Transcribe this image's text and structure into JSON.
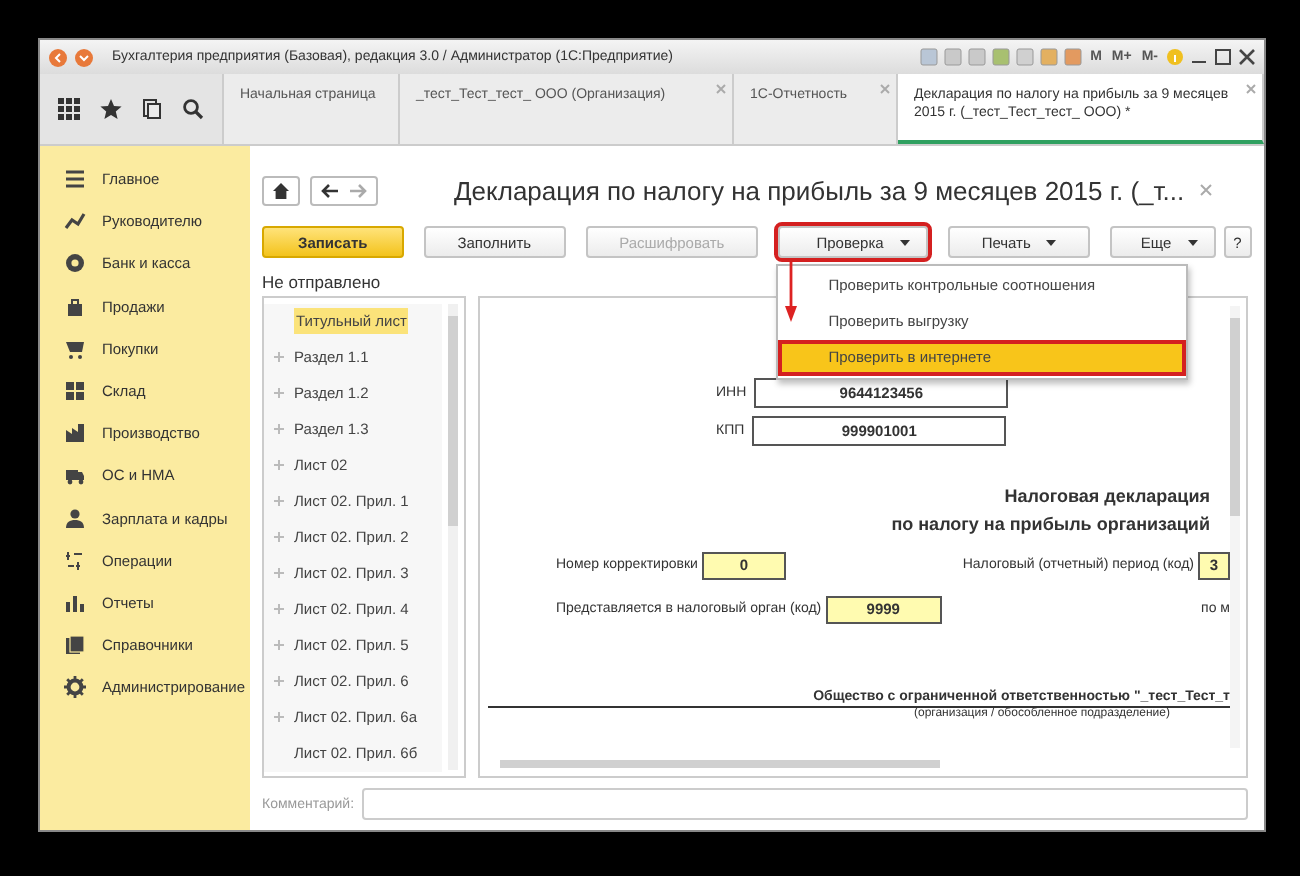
{
  "window": {
    "title": "Бухгалтерия предприятия (Базовая), редакция 3.0 / Администратор  (1С:Предприятие)",
    "memory_buttons": [
      "M",
      "M+",
      "M-"
    ]
  },
  "tabs": [
    {
      "label": "Начальная страница",
      "selected": false,
      "closable": false
    },
    {
      "label": "_тест_Тест_тест_ ООО (Организация)",
      "selected": false,
      "closable": true
    },
    {
      "label": "1С-Отчетность",
      "selected": false,
      "closable": true
    },
    {
      "label": "Декларация по налогу на прибыль за 9 месяцев 2015 г. (_тест_Тест_тест_ ООО) *",
      "selected": true,
      "closable": true
    }
  ],
  "sidebar": {
    "items": [
      {
        "label": "Главное"
      },
      {
        "label": "Руководителю"
      },
      {
        "label": "Банк и касса"
      },
      {
        "label": "Продажи"
      },
      {
        "label": "Покупки"
      },
      {
        "label": "Склад"
      },
      {
        "label": "Производство"
      },
      {
        "label": "ОС и НМА"
      },
      {
        "label": "Зарплата и кадры"
      },
      {
        "label": "Операции"
      },
      {
        "label": "Отчеты"
      },
      {
        "label": "Справочники"
      },
      {
        "label": "Администрирование"
      }
    ]
  },
  "document": {
    "title": "Декларация по налогу на прибыль за 9 месяцев 2015 г. (_т...",
    "toolbar": [
      {
        "label": "Записать",
        "kind": "primary",
        "disabled": false,
        "dropdown": false,
        "highlighted": false
      },
      {
        "label": "Заполнить",
        "kind": "normal",
        "disabled": false,
        "dropdown": false,
        "highlighted": false
      },
      {
        "label": "Расшифровать",
        "kind": "normal",
        "disabled": true,
        "dropdown": false,
        "highlighted": false
      },
      {
        "label": "Проверка",
        "kind": "normal",
        "disabled": false,
        "dropdown": true,
        "highlighted": true
      },
      {
        "label": "Печать",
        "kind": "normal",
        "disabled": false,
        "dropdown": true,
        "highlighted": false
      },
      {
        "label": "Еще",
        "kind": "more",
        "disabled": false,
        "dropdown": true,
        "highlighted": false
      },
      {
        "label": "?",
        "kind": "help",
        "disabled": false,
        "dropdown": false,
        "highlighted": false
      }
    ],
    "menu": [
      {
        "label": "Проверить контрольные соотношения",
        "selected": false
      },
      {
        "label": "Проверить выгрузку",
        "selected": false
      },
      {
        "label": "Проверить в интернете",
        "selected": true
      }
    ],
    "status": "Не отправлено",
    "sections": [
      {
        "label": "Титульный лист",
        "selected": true,
        "expandable": false
      },
      {
        "label": "Раздел 1.1",
        "selected": false,
        "expandable": true
      },
      {
        "label": "Раздел 1.2",
        "selected": false,
        "expandable": true
      },
      {
        "label": "Раздел 1.3",
        "selected": false,
        "expandable": true
      },
      {
        "label": "Лист 02",
        "selected": false,
        "expandable": true
      },
      {
        "label": "Лист 02. Прил. 1",
        "selected": false,
        "expandable": true
      },
      {
        "label": "Лист 02. Прил. 2",
        "selected": false,
        "expandable": true
      },
      {
        "label": "Лист 02. Прил. 3",
        "selected": false,
        "expandable": true
      },
      {
        "label": "Лист 02. Прил. 4",
        "selected": false,
        "expandable": true
      },
      {
        "label": "Лист 02. Прил. 5",
        "selected": false,
        "expandable": true
      },
      {
        "label": "Лист 02. Прил. 6",
        "selected": false,
        "expandable": true
      },
      {
        "label": "Лист 02. Прил. 6а",
        "selected": false,
        "expandable": true
      },
      {
        "label": "Лист 02. Прил. 6б",
        "selected": false,
        "expandable": false
      }
    ],
    "form": {
      "inn_label": "ИНН",
      "inn": "9644123456",
      "kpp_label": "КПП",
      "kpp": "999901001",
      "heading": [
        "Налоговая декларация",
        "по налогу на прибыль организаций"
      ],
      "correction_label": "Номер корректировки",
      "correction": "0",
      "period_label": "Налоговый (отчетный) период (код)",
      "period": "3",
      "authority_label": "Представляется в налоговый орган (код)",
      "authority": "9999",
      "location_label": "по м",
      "organization": "Общество с ограниченной ответственностью \"_тест_Тест_т",
      "organization_caption": "(организация / обособленное подразделение)"
    },
    "comment_label": "Комментарий:"
  }
}
